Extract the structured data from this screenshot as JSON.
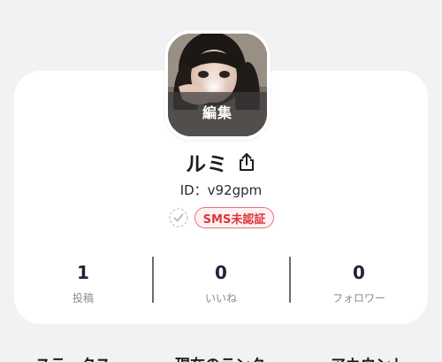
{
  "profile": {
    "avatar_edit_label": "編集",
    "name": "ルミ",
    "user_id": "ID：v92gpm",
    "sms_badge": "SMS未認証"
  },
  "stats": [
    {
      "value": "1",
      "label": "投稿"
    },
    {
      "value": "0",
      "label": "いいね"
    },
    {
      "value": "0",
      "label": "フォロワー"
    }
  ],
  "tabs": [
    {
      "label": "ステータス"
    },
    {
      "label": "現在のランク"
    },
    {
      "label": "アカウント"
    }
  ],
  "colors": {
    "accent_red": "#d9363e",
    "badge_bg": "#fff1f1",
    "stat_value": "#1f2436",
    "background": "#f2f2f4"
  },
  "icons": {
    "share": "share-icon",
    "verify": "check-circle-icon"
  }
}
